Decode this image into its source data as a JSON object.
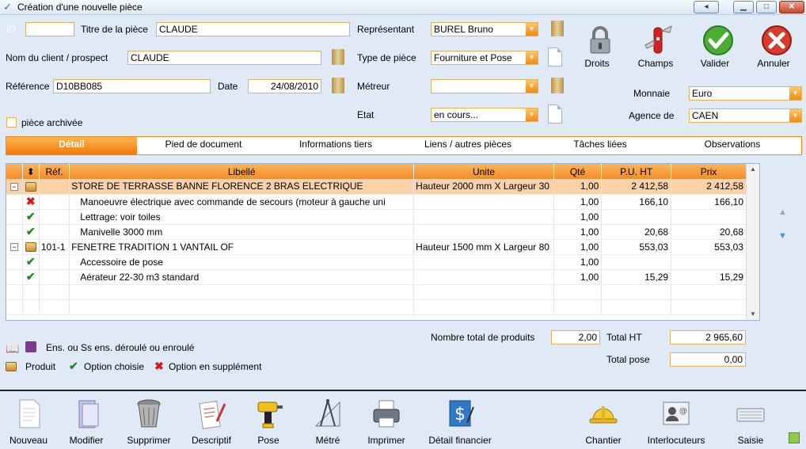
{
  "window": {
    "title": "Création d'une nouvelle pièce"
  },
  "form": {
    "id_label": "ID",
    "id_value": "",
    "titre_label": "Titre de la pièce",
    "titre_value": "CLAUDE",
    "client_label": "Nom du client / prospect",
    "client_value": "CLAUDE",
    "reference_label": "Référence",
    "reference_value": "D10BB085",
    "date_label": "Date",
    "date_value": "24/08/2010",
    "archive_label": "pièce archivée",
    "representant_label": "Représentant",
    "representant_value": "BUREL Bruno",
    "type_label": "Type de pièce",
    "type_value": "Fourniture et Pose",
    "metreur_label": "Métreur",
    "metreur_value": "",
    "etat_label": "Etat",
    "etat_value": "en cours...",
    "monnaie_label": "Monnaie",
    "monnaie_value": "Euro",
    "agence_label": "Agence de",
    "agence_value": "CAEN"
  },
  "actions": {
    "droits": "Droits",
    "champs": "Champs",
    "valider": "Valider",
    "annuler": "Annuler"
  },
  "tabs": [
    "Détail",
    "Pied de document",
    "Informations tiers",
    "Liens / autres pièces",
    "Tâches liées",
    "Observations"
  ],
  "grid": {
    "headers": [
      "Réf.",
      "Libellé",
      "Unite",
      "Qté",
      "P.U. HT",
      "Prix"
    ],
    "rows": [
      {
        "tree": "−",
        "icon": "product",
        "ref": "",
        "libelle": "STORE DE TERRASSE BANNE FLORENCE 2 BRAS ELECTRIQUE",
        "unite": "Hauteur 2000 mm X Largeur 30",
        "qte": "1,00",
        "pu": "2 412,58",
        "prix": "2 412,58",
        "selected": true,
        "indent": false
      },
      {
        "tree": "",
        "icon": "supplement",
        "ref": "",
        "libelle": "Manoeuvre électrique avec commande de secours (moteur à gauche uni",
        "unite": "",
        "qte": "1,00",
        "pu": "166,10",
        "prix": "166,10",
        "selected": false,
        "indent": true
      },
      {
        "tree": "",
        "icon": "option",
        "ref": "",
        "libelle": "Lettrage: voir toiles",
        "unite": "",
        "qte": "1,00",
        "pu": "",
        "prix": "",
        "selected": false,
        "indent": true
      },
      {
        "tree": "",
        "icon": "option",
        "ref": "",
        "libelle": "Manivelle 3000 mm",
        "unite": "",
        "qte": "1,00",
        "pu": "20,68",
        "prix": "20,68",
        "selected": false,
        "indent": true
      },
      {
        "tree": "−",
        "icon": "product",
        "ref": "101-1",
        "libelle": "FENETRE TRADITION 1 VANTAIL  OF",
        "unite": "Hauteur 1500 mm X Largeur 80",
        "qte": "1,00",
        "pu": "553,03",
        "prix": "553,03",
        "selected": false,
        "indent": false
      },
      {
        "tree": "",
        "icon": "option",
        "ref": "",
        "libelle": "Accessoire de pose",
        "unite": "",
        "qte": "1,00",
        "pu": "",
        "prix": "",
        "selected": false,
        "indent": true
      },
      {
        "tree": "",
        "icon": "option",
        "ref": "",
        "libelle": "Aérateur 22-30 m3 standard",
        "unite": "",
        "qte": "1,00",
        "pu": "15,29",
        "prix": "15,29",
        "selected": false,
        "indent": true
      }
    ],
    "empty_rows": 2
  },
  "legend": {
    "enroule": "Ens. ou Ss ens. déroulé ou enroulé",
    "produit": "Produit",
    "option": "Option choisie",
    "supplement": "Option en supplément"
  },
  "totals": {
    "nb_label": "Nombre total de produits",
    "nb_value": "2,00",
    "ht_label": "Total HT",
    "ht_value": "2 965,60",
    "pose_label": "Total pose",
    "pose_value": "0,00"
  },
  "toolbar": {
    "nouveau": "Nouveau",
    "modifier": "Modifier",
    "supprimer": "Supprimer",
    "descriptif": "Descriptif",
    "pose": "Pose",
    "metre": "Métré",
    "imprimer": "Imprimer",
    "detail_financier": "Détail financier",
    "chantier": "Chantier",
    "interlocuteurs": "Interlocuteurs",
    "saisie": "Saisie"
  }
}
